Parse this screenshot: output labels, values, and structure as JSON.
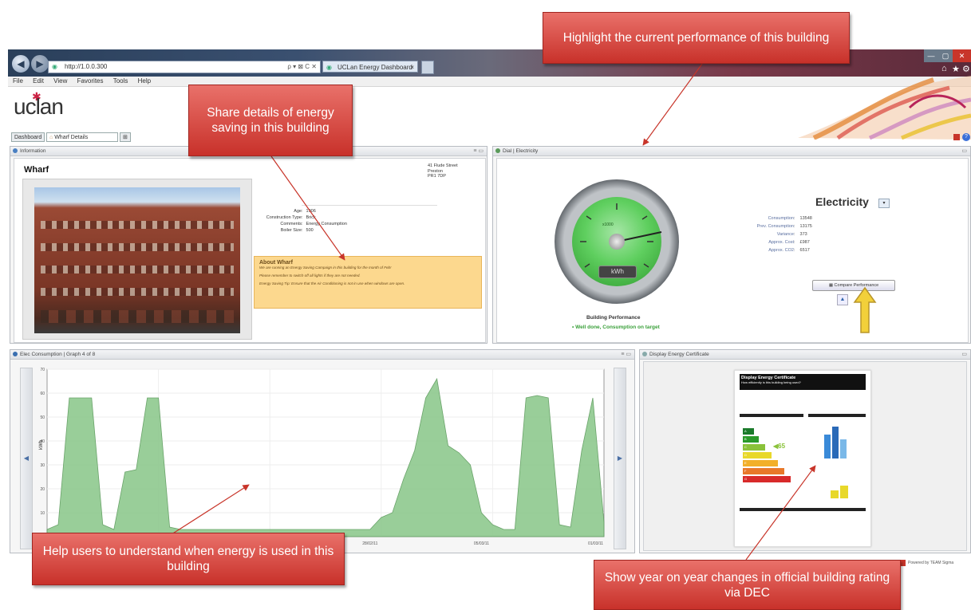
{
  "browser": {
    "url": "http://1.0.0.300",
    "url_tools": "ρ ▾ ⊠ C ✕",
    "tab_title": "UCLan Energy Dashboard",
    "tab_close": "×",
    "menu": [
      "File",
      "Edit",
      "View",
      "Favorites",
      "Tools",
      "Help"
    ],
    "window_controls": [
      "—",
      "▢",
      "✕"
    ]
  },
  "header": {
    "logo": "uclan"
  },
  "app_tabs": [
    {
      "label": "Dashboard"
    },
    {
      "label": "Wharf Details"
    }
  ],
  "info_panel": {
    "title": "Information",
    "building_name": "Wharf",
    "address": [
      "41 Flude Street",
      "Preston",
      "PR1 7DP"
    ],
    "details": [
      {
        "k": "Age",
        "v": "1906"
      },
      {
        "k": "Construction Type",
        "v": "Brick"
      },
      {
        "k": "Comments",
        "v": "Energy Consumption"
      },
      {
        "k": "Boiler Size",
        "v": "500"
      }
    ],
    "about_title": "About Wharf",
    "about_lines": [
      "We are running an Energy Saving Campaign in this building for the month of Feb!",
      "Please remember to switch off all lights if they are not needed.",
      "Energy Saving Tip: Ensure that the Air Conditioning is not in use when windows are open."
    ]
  },
  "dial_panel": {
    "title": "Dial | Electricity",
    "gauge_center_label": "x1000",
    "gauge_unit": "kWh",
    "performance_title": "Building Performance",
    "performance_status": "Well done, Consumption on target",
    "electricity_title": "Electricity",
    "stats": [
      {
        "k": "Consumption",
        "v": "13548"
      },
      {
        "k": "Prev. Consumption",
        "v": "13175"
      },
      {
        "k": "Variance",
        "v": "373"
      },
      {
        "k": "Approx. Cost",
        "v": "£987"
      },
      {
        "k": "Approx. CO2",
        "v": "6517"
      }
    ],
    "compare_button": "Compare Performance"
  },
  "graph_panel": {
    "title": "Elec Consumption | Graph 4 of 8",
    "y_axis_label": "kWh"
  },
  "dec_panel": {
    "title": "Display Energy Certificate",
    "doc_title": "Display Energy Certificate",
    "doc_subtitle": "How efficiently is this building being used?",
    "rating_value": "65",
    "bands": [
      "A",
      "B",
      "C",
      "D",
      "E",
      "F",
      "G"
    ]
  },
  "footer": {
    "powered_by": "Powered by TEAM Sigma"
  },
  "callouts": {
    "energy_saving": "Share details of energy saving in this building",
    "performance": "Highlight the current performance of this building",
    "usage": "Help users to understand when energy is used in this building",
    "dec": "Show year on year changes in official building rating via DEC"
  },
  "chart_data": {
    "type": "area",
    "title": "",
    "xlabel": "",
    "ylabel": "kWh",
    "ylim": [
      0,
      70
    ],
    "yticks": [
      10,
      20,
      30,
      40,
      50,
      60,
      70
    ],
    "x_ticks": [
      "28/02/11",
      "05/03/11",
      "01/03/11"
    ],
    "x": [
      0,
      2,
      4,
      6,
      8,
      10,
      12,
      14,
      16,
      18,
      20,
      22,
      24,
      26,
      28,
      30,
      32,
      34,
      36,
      38,
      40,
      42,
      44,
      46,
      48,
      50,
      52,
      54,
      56,
      58,
      60,
      62,
      64,
      66,
      68,
      70,
      72,
      74,
      76,
      78,
      80,
      82,
      84,
      86,
      88,
      90,
      92,
      94,
      96,
      98,
      100
    ],
    "values": [
      3,
      5,
      58,
      58,
      58,
      5,
      3,
      27,
      28,
      58,
      58,
      4,
      3,
      3,
      3,
      3,
      3,
      3,
      3,
      3,
      3,
      3,
      3,
      3,
      3,
      3,
      3,
      3,
      3,
      3,
      8,
      10,
      24,
      36,
      58,
      66,
      38,
      35,
      30,
      10,
      5,
      3,
      3,
      58,
      59,
      58,
      5,
      4,
      36,
      58,
      6
    ],
    "series": [
      {
        "values": [
          3,
          5,
          58,
          58,
          58,
          5,
          3,
          27,
          28,
          58,
          58,
          4,
          3,
          3,
          3,
          3,
          3,
          3,
          3,
          3,
          3,
          3,
          3,
          3,
          3,
          3,
          3,
          3,
          3,
          3,
          8,
          10,
          24,
          36,
          58,
          66,
          38,
          35,
          30,
          10,
          5,
          3,
          3,
          58,
          59,
          58,
          5,
          4,
          36,
          58,
          6
        ],
        "color": "#8fc98f"
      }
    ]
  },
  "colors": {
    "callout": "#d9463d",
    "gauge_green": "#4caf50",
    "area_fill": "#8fc98f",
    "about_bg": "#fcd88e",
    "arrow": "#e8c12a"
  }
}
